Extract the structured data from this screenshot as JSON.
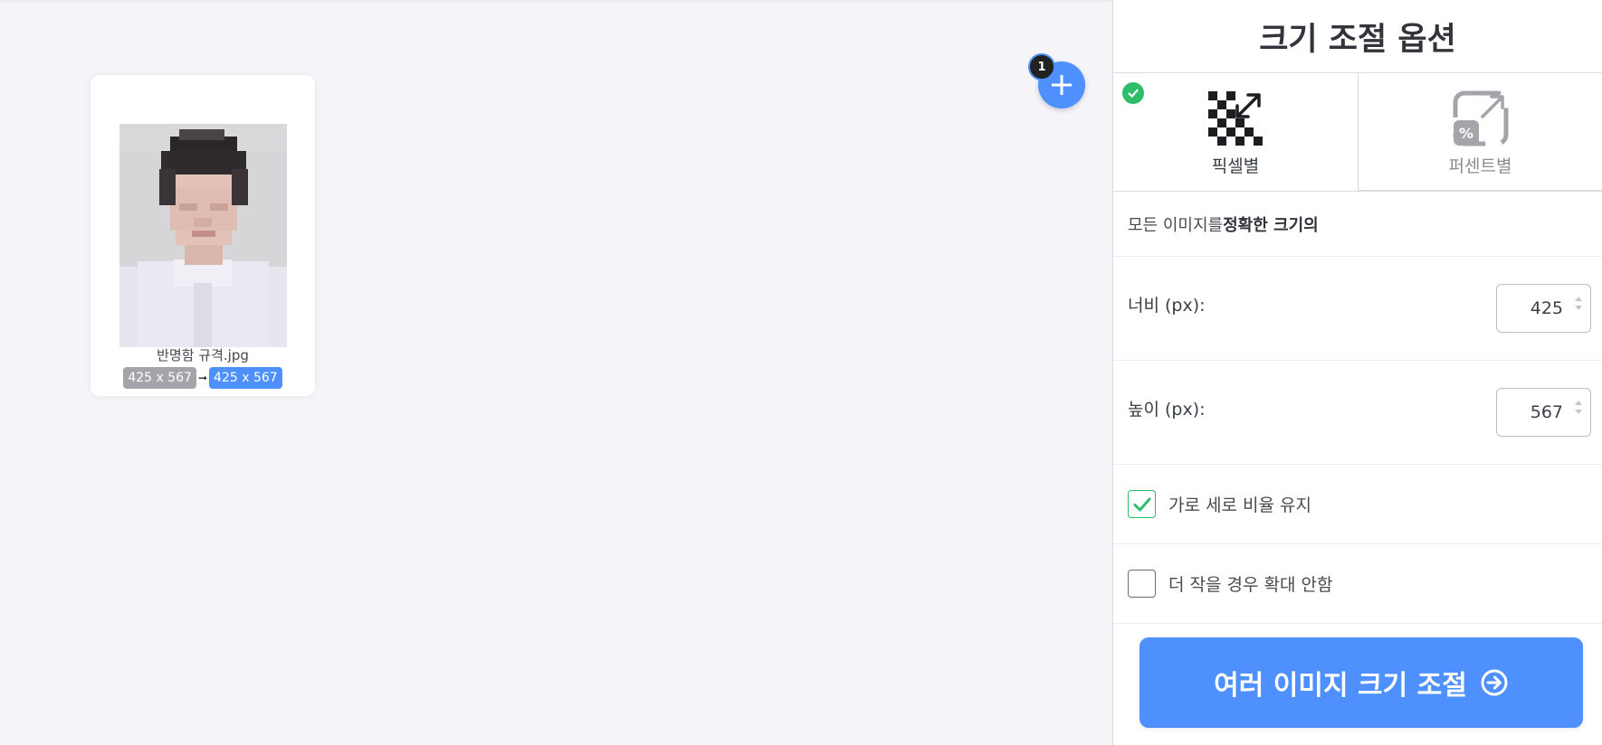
{
  "file_card": {
    "file_name": "반명함 규격.jpg",
    "original_size": "425 x 567",
    "arrow": "➞",
    "new_size": "425 x 567"
  },
  "add_button": {
    "count": "1",
    "icon": "plus-icon"
  },
  "sidebar": {
    "title": "크기 조절 옵션",
    "tabs": [
      {
        "label": "픽셀별",
        "icon": "pixel-resize-icon",
        "active": true
      },
      {
        "label": "퍼센트별",
        "icon": "percent-resize-icon",
        "active": false
      }
    ],
    "description_prefix": "모든 이미지를",
    "description_bold": "정확한 크기의",
    "width_label": "너비 (px):",
    "width_value": "425",
    "height_label": "높이 (px):",
    "height_value": "567",
    "keep_ratio_label": "가로 세로 비율 유지",
    "keep_ratio_checked": true,
    "no_enlarge_label": "더 작을 경우 확대 안함",
    "no_enlarge_checked": false,
    "submit_label": "여러 이미지 크기 조절",
    "submit_icon": "arrow-circle-right-icon"
  },
  "colors": {
    "accent": "#4d90fe",
    "success": "#2ebd6b",
    "background": "#f4f4f9"
  }
}
